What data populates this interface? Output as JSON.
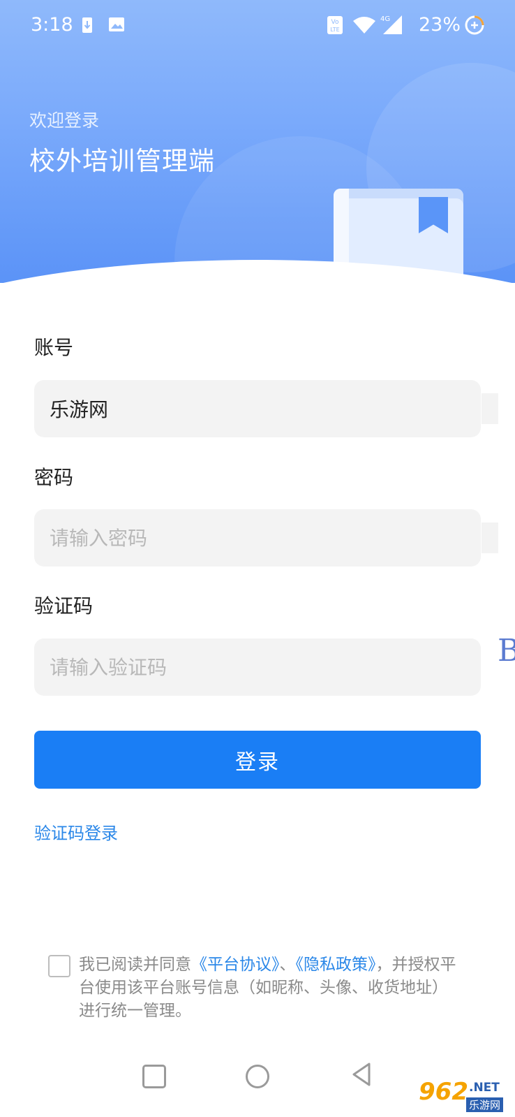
{
  "status_bar": {
    "time": "3:18",
    "battery": "23%",
    "icons": [
      "download-notification-icon",
      "image-notification-icon",
      "volte-icon",
      "wifi-icon",
      "4g-signal-icon",
      "battery-saver-icon"
    ]
  },
  "header": {
    "welcome": "欢迎登录",
    "title": "校外培训管理端"
  },
  "form": {
    "account_label": "账号",
    "account_value": "乐游网",
    "password_label": "密码",
    "password_placeholder": "请输入密码",
    "captcha_label": "验证码",
    "captcha_placeholder": "请输入验证码",
    "captcha_peek": "B",
    "login_button": "登录",
    "sms_login_link": "验证码登录"
  },
  "agreement": {
    "prefix": "我已阅读并同意",
    "platform_link": "《平台协议》",
    "separator": "、",
    "privacy_link": "《隐私政策》",
    "suffix": "，并授权平台使用该平台账号信息（如昵称、头像、收货地址）进行统一管理。"
  },
  "watermark": {
    "number": "962",
    "net": ".NET",
    "site": "乐游网"
  },
  "colors": {
    "accent": "#1a7ef5",
    "link": "#2a87e8",
    "header_gradient_top": "#8fb9fb",
    "header_gradient_bottom": "#5b93f7"
  }
}
